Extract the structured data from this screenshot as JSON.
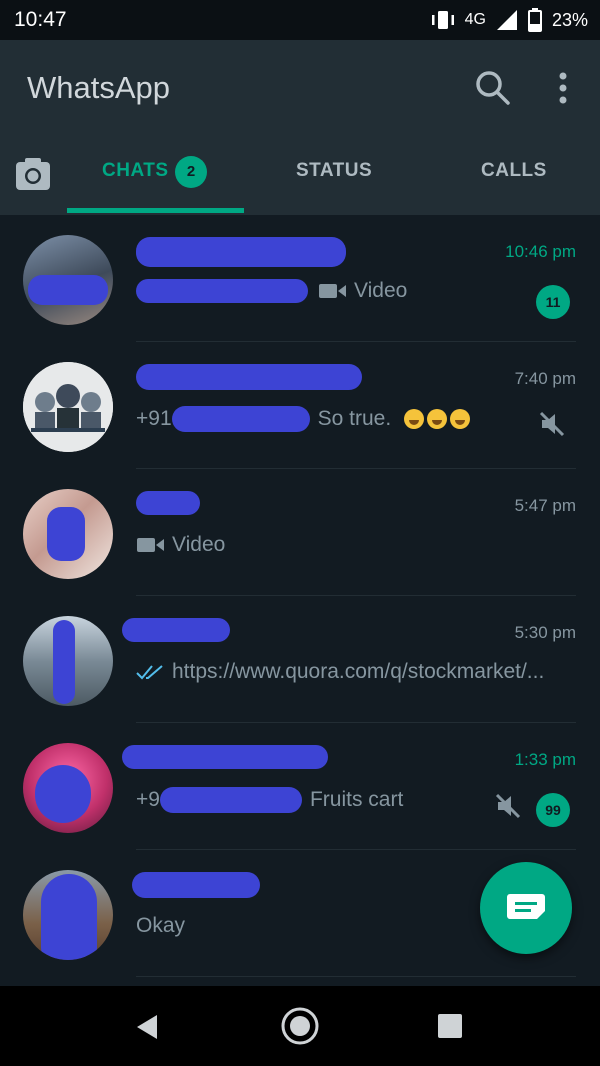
{
  "status_bar": {
    "time": "10:47",
    "network": "4G",
    "battery": "23%"
  },
  "app": {
    "title": "WhatsApp"
  },
  "tabs": {
    "chats": "CHATS",
    "chats_badge": "2",
    "status": "STATUS",
    "calls": "CALLS"
  },
  "chats": [
    {
      "time": "10:46 pm",
      "preview": "Video",
      "unread": "11"
    },
    {
      "time": "7:40 pm",
      "preview_prefix": "+91",
      "preview": "So true."
    },
    {
      "time": "5:47 pm",
      "preview": "Video"
    },
    {
      "time": "5:30 pm",
      "preview": "https://www.quora.com/q/stockmarket/..."
    },
    {
      "time": "1:33 pm",
      "preview_prefix": "+9",
      "preview": "Fruits cart",
      "unread": "99"
    },
    {
      "preview": "Okay"
    }
  ],
  "colors": {
    "accent": "#00a884",
    "appbar": "#222e35",
    "background": "#121b22",
    "redaction": "#3d44d4"
  },
  "icons": [
    "search-icon",
    "menu-icon",
    "camera-icon",
    "video-icon",
    "double-check-icon",
    "mute-icon",
    "new-chat-icon",
    "back-icon",
    "home-icon",
    "recents-icon"
  ]
}
